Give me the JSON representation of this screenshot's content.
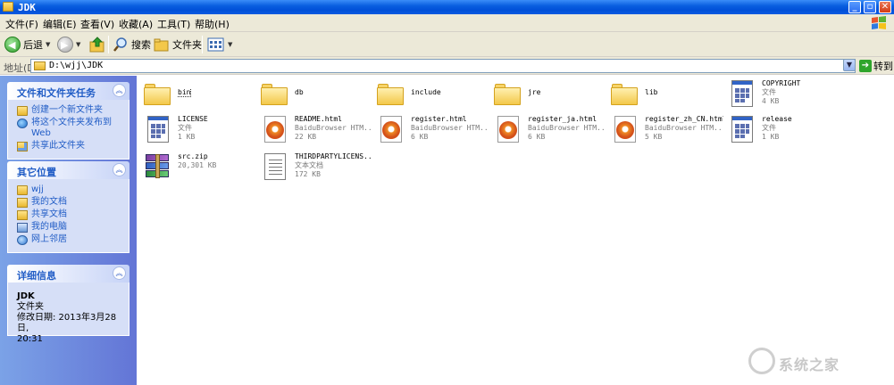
{
  "window": {
    "title": "JDK"
  },
  "menu": [
    "文件(F)",
    "编辑(E)",
    "查看(V)",
    "收藏(A)",
    "工具(T)",
    "帮助(H)"
  ],
  "toolbar": {
    "back": "后退",
    "search": "搜索",
    "folders": "文件夹"
  },
  "address": {
    "label": "地址(D)",
    "path": "D:\\wjj\\JDK",
    "go": "转到"
  },
  "tasks_panel": {
    "title": "文件和文件夹任务",
    "items": [
      "创建一个新文件夹",
      "将这个文件夹发布到 Web",
      "共享此文件夹"
    ]
  },
  "places_panel": {
    "title": "其它位置",
    "items": [
      "wjj",
      "我的文档",
      "共享文档",
      "我的电脑",
      "网上邻居"
    ]
  },
  "details_panel": {
    "title": "详细信息",
    "name": "JDK",
    "type": "文件夹",
    "modified_label": "修改日期: 2013年3月28日,",
    "modified_time": "20:31"
  },
  "files": [
    {
      "name": "bin",
      "kind": "folder",
      "type": "",
      "size": ""
    },
    {
      "name": "db",
      "kind": "folder",
      "type": "",
      "size": ""
    },
    {
      "name": "include",
      "kind": "folder",
      "type": "",
      "size": ""
    },
    {
      "name": "jre",
      "kind": "folder",
      "type": "",
      "size": ""
    },
    {
      "name": "lib",
      "kind": "folder",
      "type": "",
      "size": ""
    },
    {
      "name": "COPYRIGHT",
      "kind": "generic",
      "type": "文件",
      "size": "4 KB"
    },
    {
      "name": "LICENSE",
      "kind": "generic",
      "type": "文件",
      "size": "1 KB"
    },
    {
      "name": "README.html",
      "kind": "html",
      "type": "BaiduBrowser HTM...",
      "size": "22 KB"
    },
    {
      "name": "register.html",
      "kind": "html",
      "type": "BaiduBrowser HTM...",
      "size": "6 KB"
    },
    {
      "name": "register_ja.html",
      "kind": "html",
      "type": "BaiduBrowser HTM...",
      "size": "6 KB"
    },
    {
      "name": "register_zh_CN.html",
      "kind": "html",
      "type": "BaiduBrowser HTM...",
      "size": "5 KB"
    },
    {
      "name": "release",
      "kind": "generic",
      "type": "文件",
      "size": "1 KB"
    },
    {
      "name": "src.zip",
      "kind": "zip",
      "type": "",
      "size": "20,301 KB"
    },
    {
      "name": "THIRDPARTYLICENS...",
      "kind": "text",
      "type": "文本文档",
      "size": "172 KB"
    }
  ],
  "watermark": "系统之家"
}
